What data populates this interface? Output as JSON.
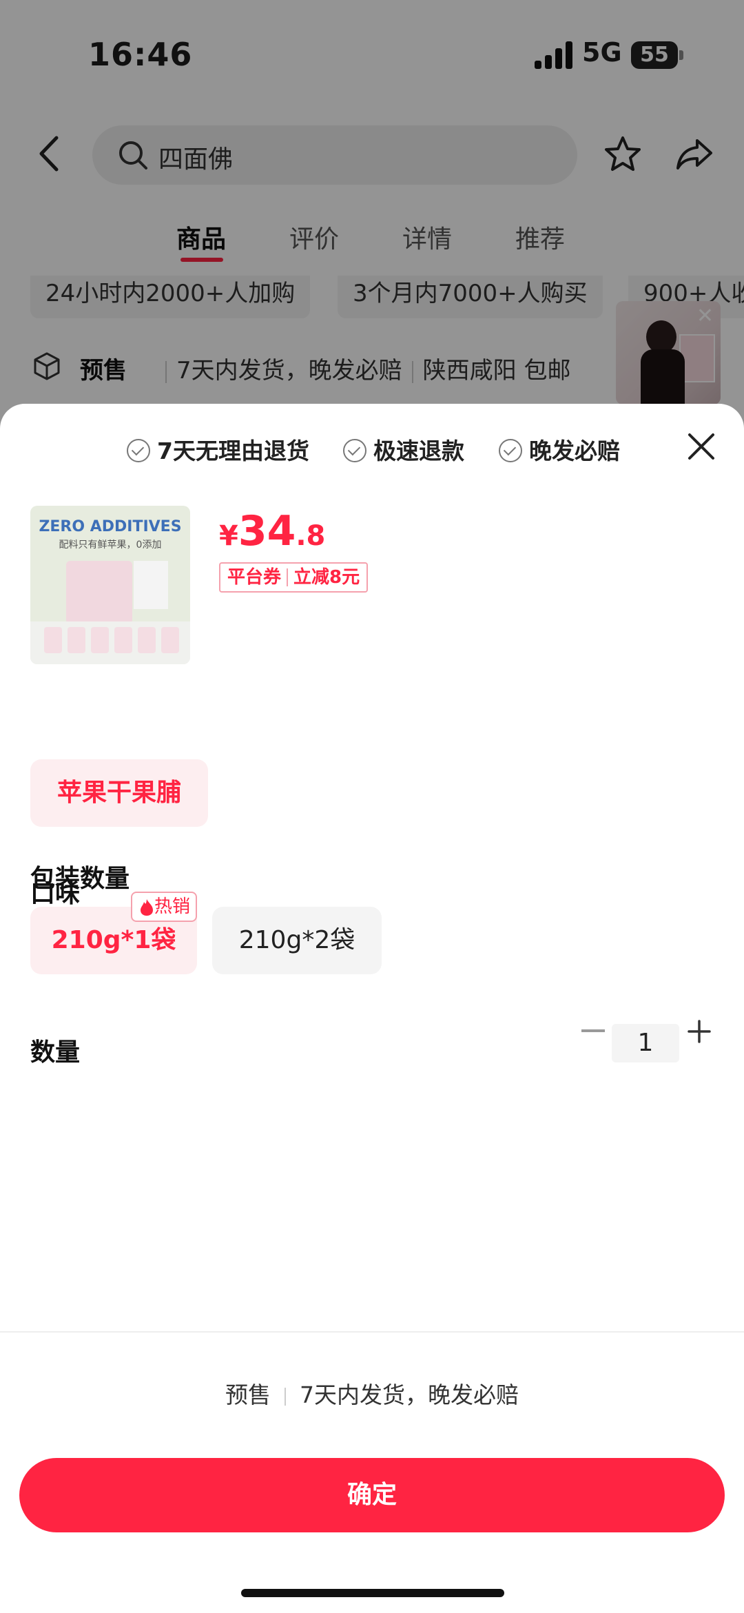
{
  "status_bar": {
    "time": "16:46",
    "network": "5G",
    "battery": "55"
  },
  "search": {
    "query": "四面佛"
  },
  "tabs": [
    {
      "label": "商品",
      "active": true
    },
    {
      "label": "评价",
      "active": false
    },
    {
      "label": "详情",
      "active": false
    },
    {
      "label": "推荐",
      "active": false
    }
  ],
  "chips": [
    "24小时内2000+人加购",
    "3个月内7000+人购买",
    "900+人收"
  ],
  "presale_row": {
    "badge": "预售",
    "shipping": "7天内发货，晚发必赔",
    "origin": "陕西咸阳 包邮"
  },
  "sheet": {
    "guarantees": [
      "7天无理由退货",
      "极速退款",
      "晚发必赔"
    ],
    "product_image": {
      "headline": "ZERO ADDITIVES",
      "subline": "配料只有鲜苹果，0添加"
    },
    "price": {
      "currency": "¥",
      "integer": "34",
      "decimal": ".8"
    },
    "coupon": {
      "label": "平台券",
      "discount": "立减8元"
    },
    "flavor": {
      "title": "口味",
      "options": [
        {
          "label": "苹果干果脯",
          "selected": true
        }
      ]
    },
    "pack": {
      "title": "包装数量",
      "options": [
        {
          "label": "210g*1袋",
          "selected": true,
          "tag": "热销"
        },
        {
          "label": "210g*2袋",
          "selected": false
        }
      ]
    },
    "quantity": {
      "title": "数量",
      "value": "1"
    },
    "footer_note": {
      "badge": "预售",
      "text": "7天内发货，晚发必赔"
    },
    "confirm_label": "确定"
  },
  "colors": {
    "accent": "#ff2442",
    "selected_bg": "#fdeef0"
  }
}
